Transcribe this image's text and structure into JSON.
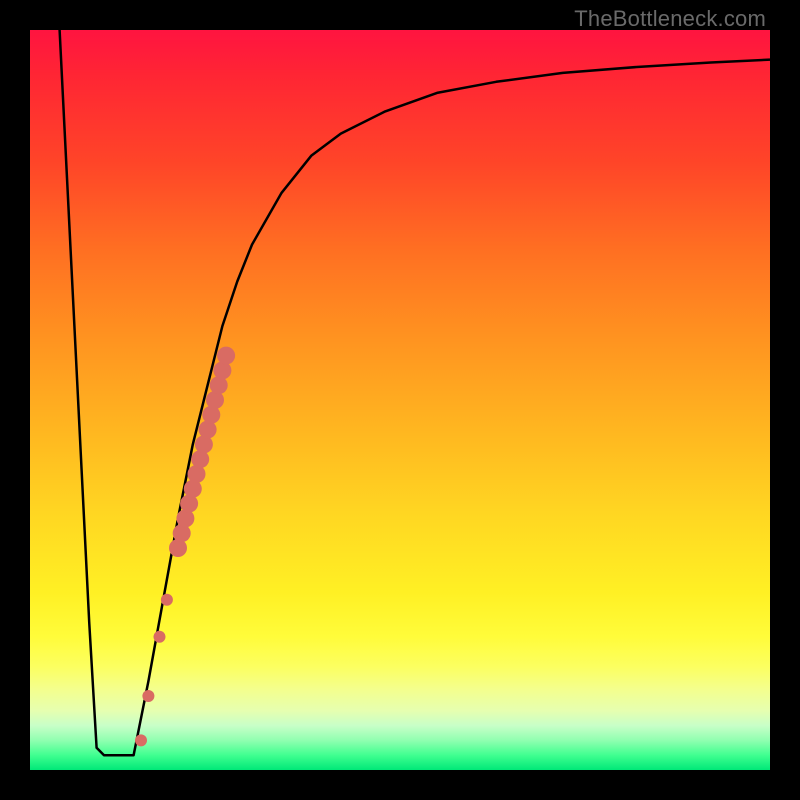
{
  "watermark": "TheBottleneck.com",
  "colors": {
    "frame": "#000000",
    "curve": "#000000",
    "marker": "#d96b63"
  },
  "chart_data": {
    "type": "line",
    "title": "",
    "xlabel": "",
    "ylabel": "",
    "xlim": [
      0,
      100
    ],
    "ylim": [
      0,
      100
    ],
    "series": [
      {
        "name": "left-descent",
        "x": [
          4,
          5,
          6,
          7,
          8,
          9,
          10
        ],
        "values": [
          100,
          80,
          60,
          40,
          20,
          3,
          2
        ]
      },
      {
        "name": "floor",
        "x": [
          10,
          11,
          12,
          13,
          14
        ],
        "values": [
          2,
          2,
          2,
          2,
          2
        ]
      },
      {
        "name": "right-ascent",
        "x": [
          14,
          16,
          18,
          20,
          22,
          24,
          26,
          28,
          30,
          34,
          38,
          42,
          48,
          55,
          63,
          72,
          82,
          92,
          100
        ],
        "values": [
          2,
          12,
          23,
          34,
          44,
          52,
          60,
          66,
          71,
          78,
          83,
          86,
          89,
          91.5,
          93,
          94.2,
          95,
          95.6,
          96
        ]
      }
    ],
    "markers": {
      "name": "highlight-segment",
      "x": [
        15.0,
        16.0,
        17.5,
        18.5,
        20.0,
        20.5,
        21.0,
        21.5,
        22.0,
        22.5,
        23.0,
        23.5,
        24.0,
        24.5,
        25.0,
        25.5,
        26.0,
        26.5
      ],
      "values": [
        4,
        10,
        18,
        23,
        30,
        32,
        34,
        36,
        38,
        40,
        42,
        44,
        46,
        48,
        50,
        52,
        54,
        56
      ],
      "radius": [
        6,
        6,
        6,
        6,
        9,
        9,
        9,
        9,
        9,
        9,
        9,
        9,
        9,
        9,
        9,
        9,
        9,
        9
      ]
    }
  }
}
